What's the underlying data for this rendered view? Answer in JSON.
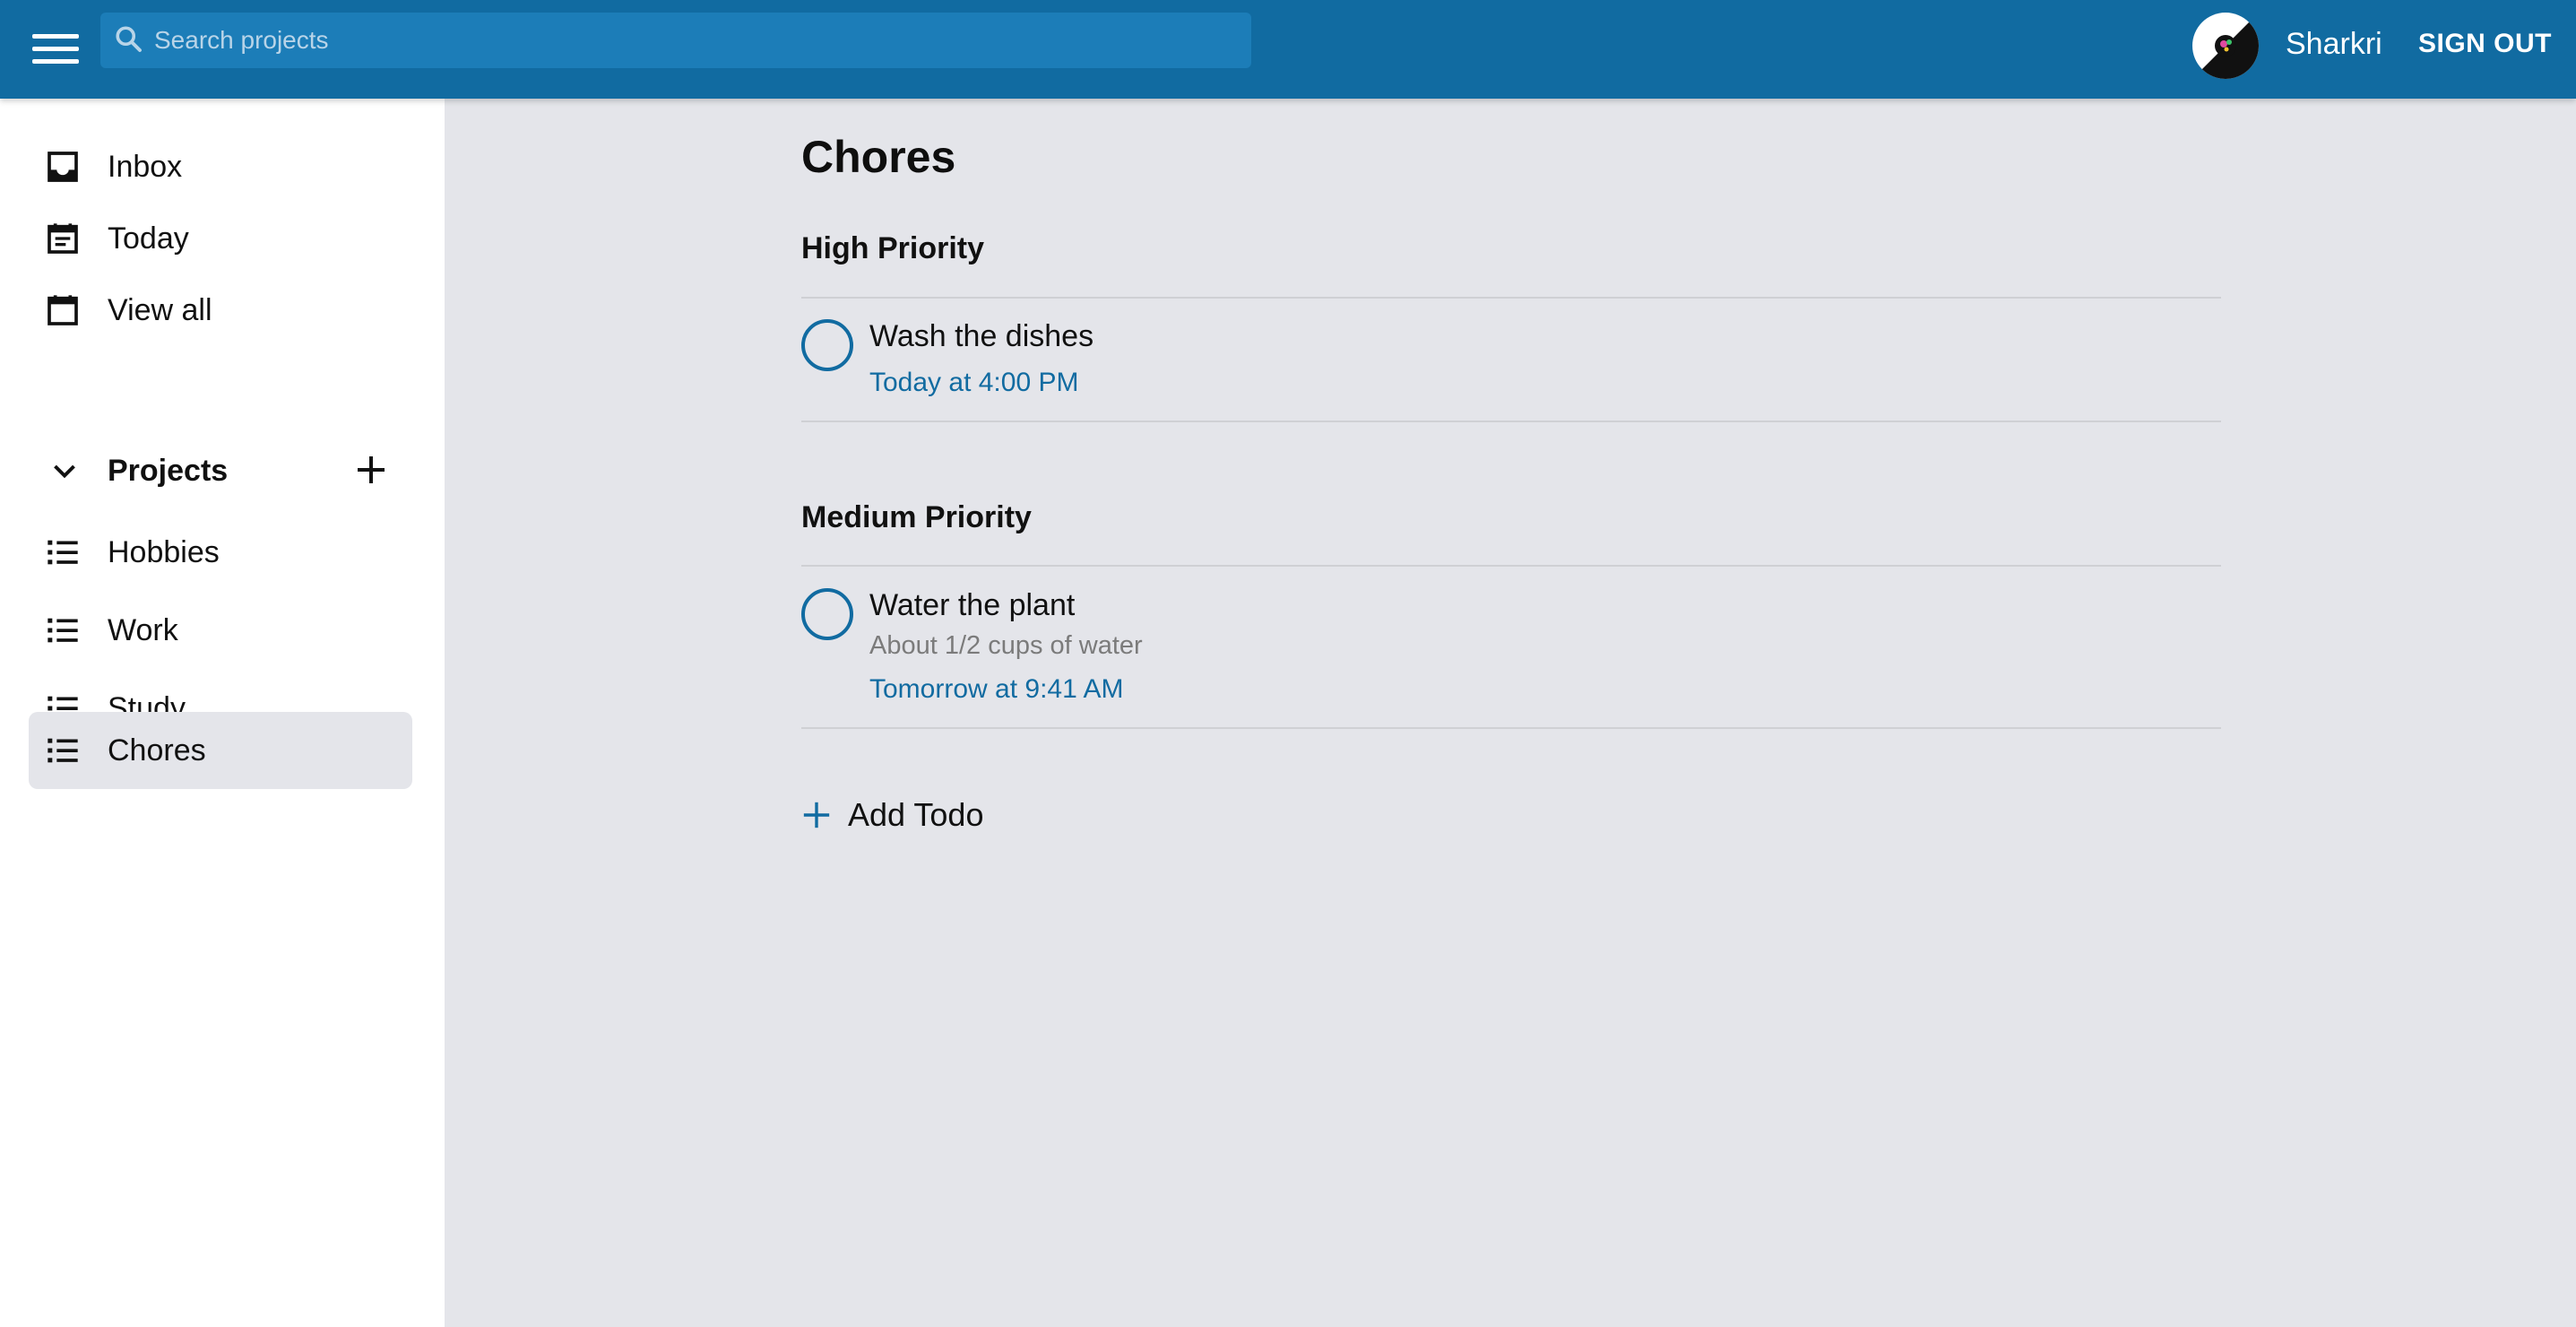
{
  "header": {
    "search_placeholder": "Search projects",
    "username": "Sharkri",
    "signout_label": "SIGN OUT",
    "bar_color": "#116ba1"
  },
  "sidebar": {
    "nav": [
      {
        "label": "Inbox",
        "icon": "inbox-icon"
      },
      {
        "label": "Today",
        "icon": "calendar-today-icon"
      },
      {
        "label": "View all",
        "icon": "calendar-month-icon"
      }
    ],
    "projects_label": "Projects",
    "projects": [
      {
        "label": "Hobbies",
        "icon": "list-icon"
      },
      {
        "label": "Work",
        "icon": "list-icon"
      },
      {
        "label": "Study",
        "icon": "list-icon"
      },
      {
        "label": "Chores",
        "icon": "list-icon",
        "active": true
      }
    ]
  },
  "main": {
    "title": "Chores",
    "sections": [
      {
        "title": "High Priority",
        "todos": [
          {
            "title": "Wash the dishes",
            "note": "",
            "due": "Today at 4:00 PM"
          }
        ]
      },
      {
        "title": "Medium Priority",
        "todos": [
          {
            "title": "Water the plant",
            "note": "About 1/2 cups of water",
            "due": "Tomorrow at 9:41 AM"
          }
        ]
      }
    ],
    "add_todo_label": "Add Todo",
    "accent_color": "#116ba1"
  }
}
